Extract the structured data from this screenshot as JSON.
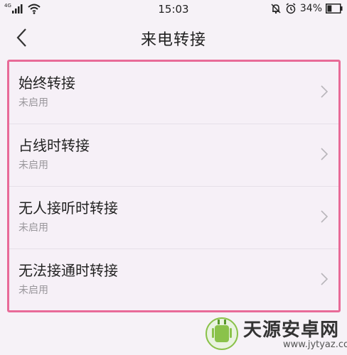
{
  "status_bar": {
    "network": "4G",
    "time": "15:03",
    "battery_percent": "34%",
    "battery_level": 0.34,
    "icons": [
      "signal-icon",
      "wifi-icon",
      "bell-off-icon",
      "alarm-icon",
      "battery-icon"
    ]
  },
  "header": {
    "title": "来电转接",
    "back_icon": "back-arrow-icon"
  },
  "forwarding_options": [
    {
      "title": "始终转接",
      "status": "未启用"
    },
    {
      "title": "占线时转接",
      "status": "未启用"
    },
    {
      "title": "无人接听时转接",
      "status": "未启用"
    },
    {
      "title": "无法接通时转接",
      "status": "未启用"
    }
  ],
  "watermark": {
    "brand": "天源安卓网",
    "url": "www.jytyaz.com"
  },
  "colors": {
    "background": "#f6f2f7",
    "highlight_border": "#e86b98",
    "secondary_text": "#9a979c"
  }
}
